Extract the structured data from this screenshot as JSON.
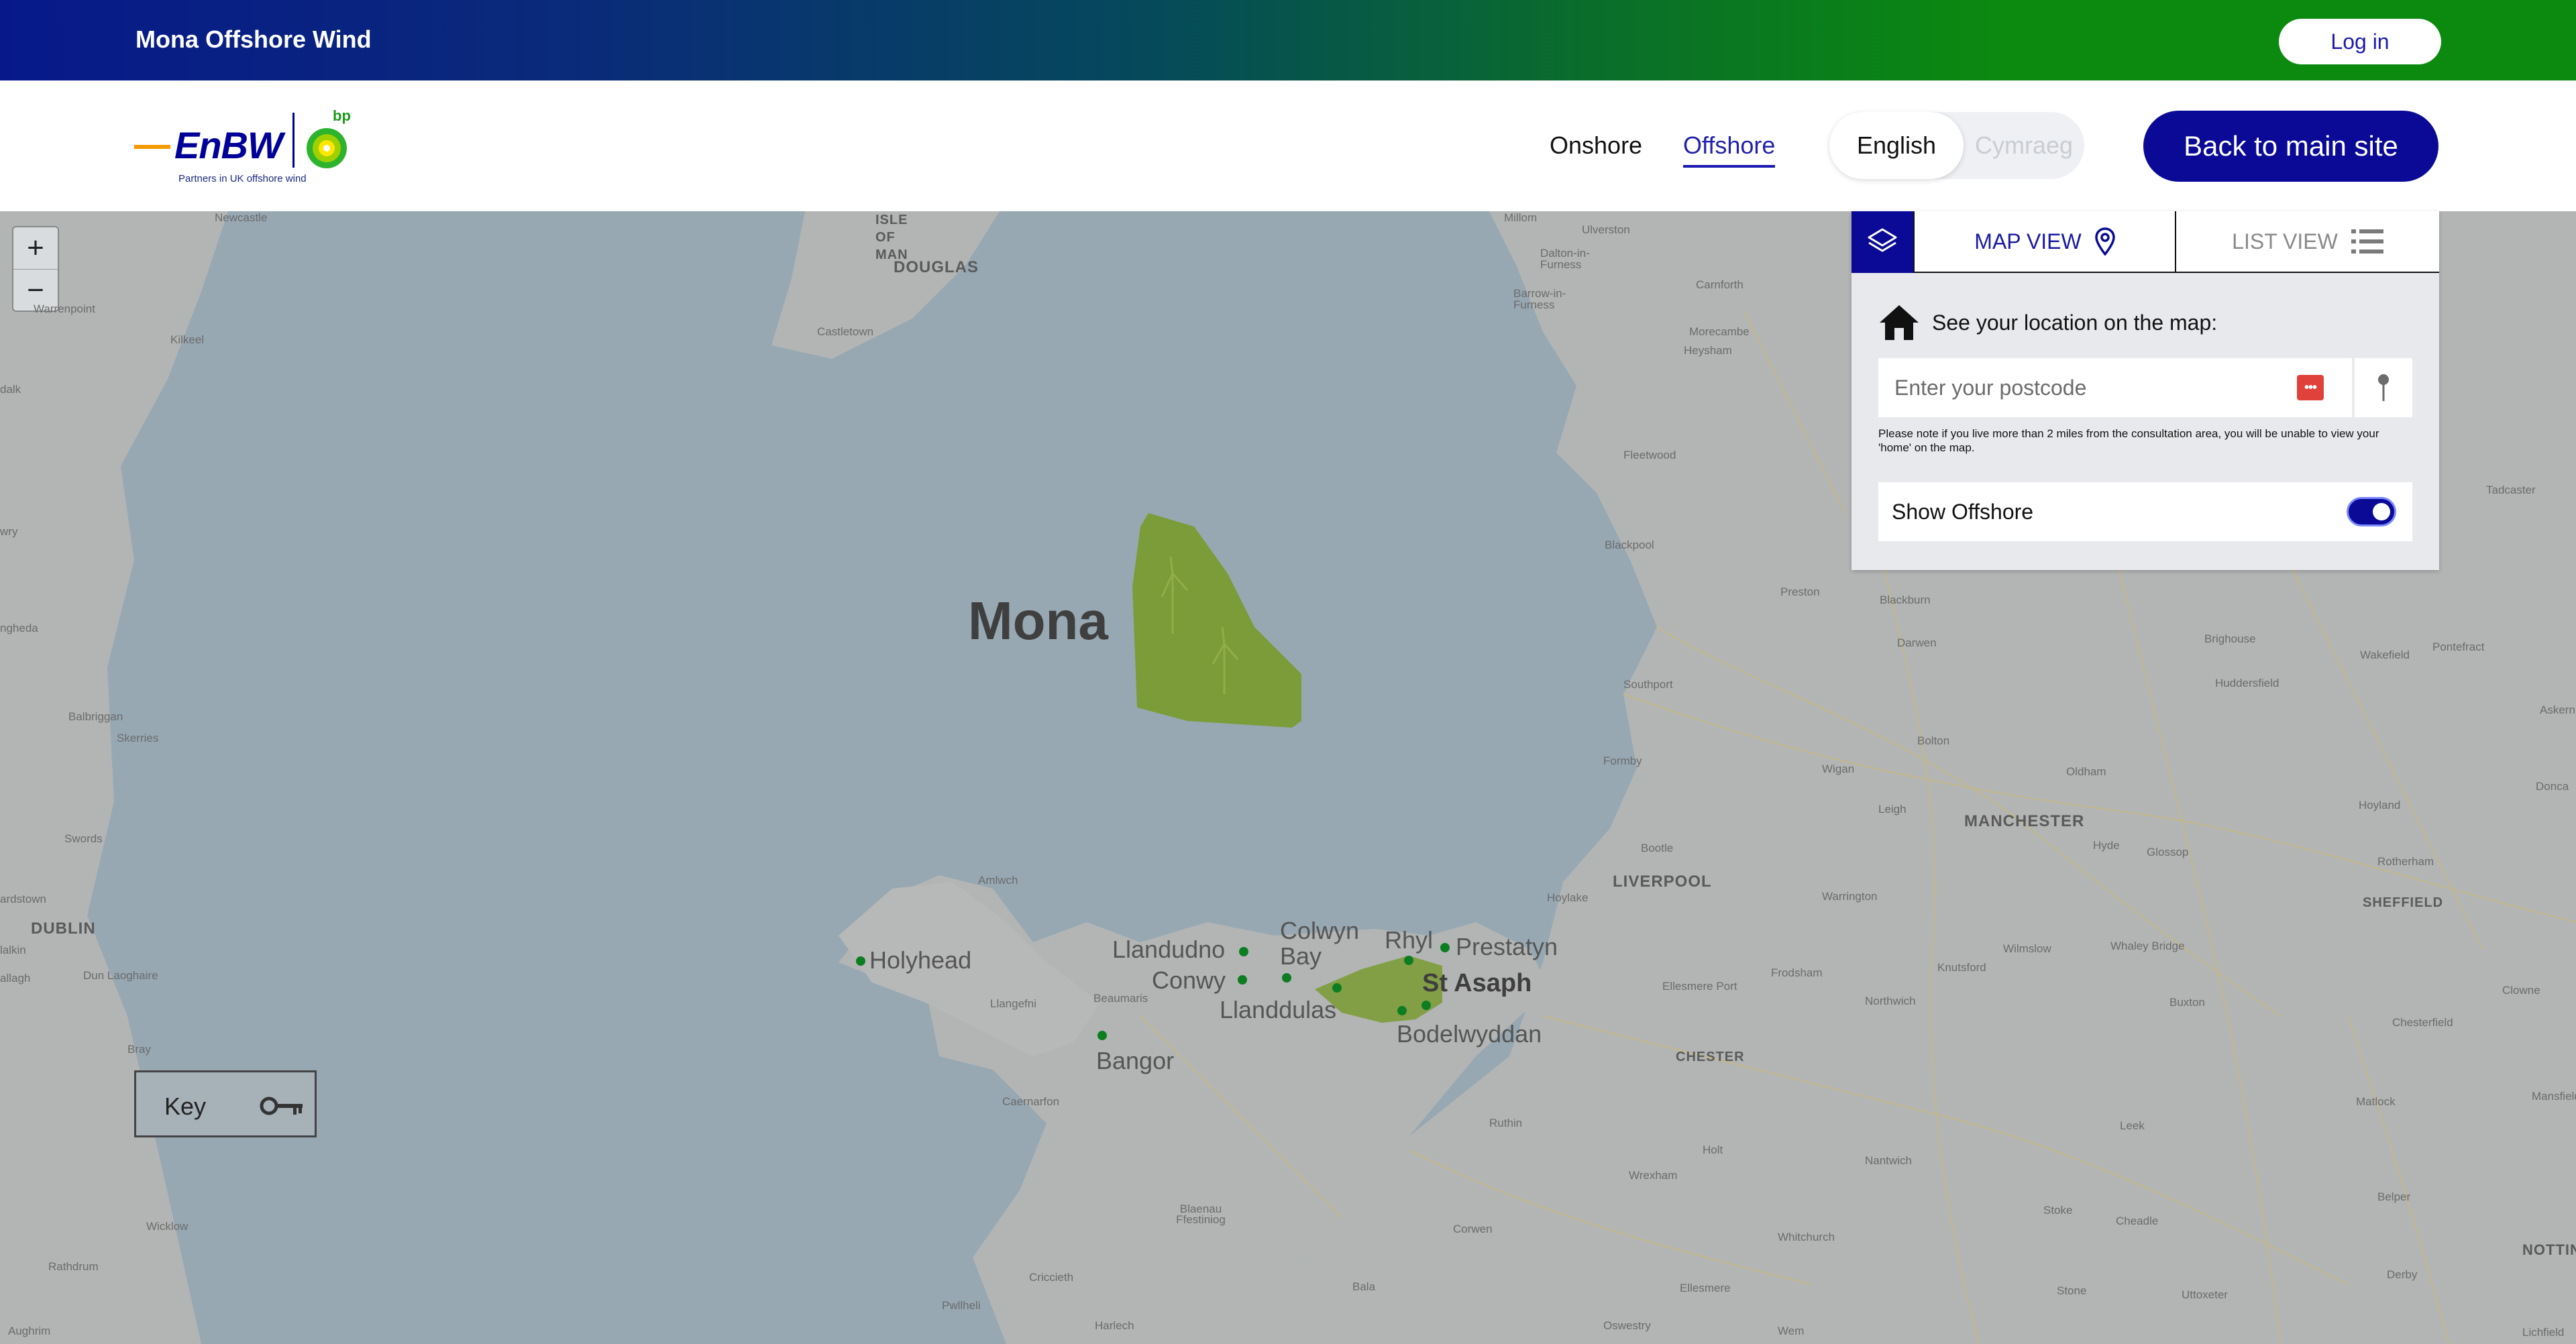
{
  "topbar": {
    "title": "Mona Offshore Wind",
    "login_label": "Log in"
  },
  "header": {
    "logo": {
      "brand": "EnBW",
      "partner": "bp",
      "tagline": "Partners in UK offshore wind"
    },
    "nav": {
      "onshore": "Onshore",
      "offshore": "Offshore"
    },
    "language": {
      "english": "English",
      "welsh": "Cymraeg",
      "selected": "English"
    },
    "back_label": "Back to main site"
  },
  "panel": {
    "tabs": {
      "map_view": "MAP VIEW",
      "list_view": "LIST VIEW",
      "active": "MAP VIEW"
    },
    "location_heading": "See your location on the map:",
    "postcode_placeholder": "Enter your postcode",
    "note": "Please note if you live more than 2 miles from the consultation area, you will be unable to view your 'home' on the map.",
    "show_offshore_label": "Show Offshore",
    "show_offshore_on": true
  },
  "map": {
    "zoom_in": "+",
    "zoom_out": "−",
    "key_label": "Key",
    "site_label": "Mona",
    "town_labels": {
      "holyhead": "Holyhead",
      "llandudno": "Llandudno",
      "colwyn_bay": "Colwyn Bay",
      "conwy": "Conwy",
      "llanddulas": "Llanddulas",
      "rhyl": "Rhyl",
      "prestatyn": "Prestatyn",
      "st_asaph": "St Asaph",
      "bodelwyddan": "Bodelwyddan",
      "bangor": "Bangor"
    },
    "place_labels": {
      "douglas": "DOUGLAS",
      "isle_of_man": "ISLE OF MAN",
      "dublin": "DUBLIN",
      "liverpool": "LIVERPOOL",
      "manchester": "MANCHESTER",
      "chester": "CHESTER",
      "sheffield": "SHEFFIELD",
      "nottingham": "NOTTING",
      "newcastle": "Newcastle",
      "warrenpoint": "Warrenpoint",
      "kilkeel": "Kilkeel",
      "castletown": "Castletown",
      "millom": "Millom",
      "ulverston": "Ulverston",
      "dalton": "Dalton-in-Furness",
      "barrow": "Barrow-in-Furness",
      "carnforth": "Carnforth",
      "morecambe": "Morecambe",
      "heysham": "Heysham",
      "fleetwood": "Fleetwood",
      "blackpool": "Blackpool",
      "preston": "Preston",
      "blackburn": "Blackburn",
      "darwen": "Darwen",
      "southport": "Southport",
      "formby": "Formby",
      "bolton": "Bolton",
      "wigan": "Wigan",
      "leigh": "Leigh",
      "oldham": "Oldham",
      "hyde": "Hyde",
      "glossop": "Glossop",
      "brighouse": "Brighouse",
      "huddersfield": "Huddersfield",
      "wakefield": "Wakefield",
      "pontefract": "Pontefract",
      "tadcaster": "Tadcaster",
      "askern": "Askern",
      "doncaster": "Donca",
      "hoyland": "Hoyland",
      "rotherham": "Rotherham",
      "bootle": "Bootle",
      "hoylake": "Hoylake",
      "warrington": "Warrington",
      "wilmslow": "Wilmslow",
      "whaley_bridge": "Whaley Bridge",
      "knutsford": "Knutsford",
      "frodsham": "Frodsham",
      "ellesmere_port": "Ellesmere Port",
      "northwich": "Northwich",
      "buxton": "Buxton",
      "clowne": "Clowne",
      "chesterfield": "Chesterfield",
      "mansfield": "Mansfield",
      "matlock": "Matlock",
      "leek": "Leek",
      "nantwich": "Nantwich",
      "holt": "Holt",
      "wrexham": "Wrexham",
      "ruthin": "Ruthin",
      "corwen": "Corwen",
      "bala": "Bala",
      "whitchurch": "Whitchurch",
      "ellesmere": "Ellesmere",
      "oswestry": "Oswestry",
      "wem": "Wem",
      "stone": "Stone",
      "uttoxeter": "Uttoxeter",
      "derby": "Derby",
      "belper": "Belper",
      "cheadle": "Cheadle",
      "stoke": "Stoke",
      "amlwch": "Amlwch",
      "llangefni": "Llangefni",
      "beaumaris": "Beaumaris",
      "caernarfon": "Caernarfon",
      "blaenau": "Blaenau Ffestiniog",
      "criccieth": "Criccieth",
      "pwllheli": "Pwllheli",
      "harlech": "Harlech",
      "drogheda": "ngheda",
      "balbriggan": "Balbriggan",
      "skerries": "Skerries",
      "swords": "Swords",
      "dundalk": "dalk",
      "newry": "wry",
      "naas": "lalkin",
      "dun_laoghaire": "Dun Laoghaire",
      "bray": "Bray",
      "wicklow": "Wicklow",
      "rathdrum": "Rathdrum",
      "aughrim": "Aughrim",
      "ardstown": "ardstown",
      "ballinteer": "allagh",
      "lichfield": "Lichfield"
    }
  }
}
